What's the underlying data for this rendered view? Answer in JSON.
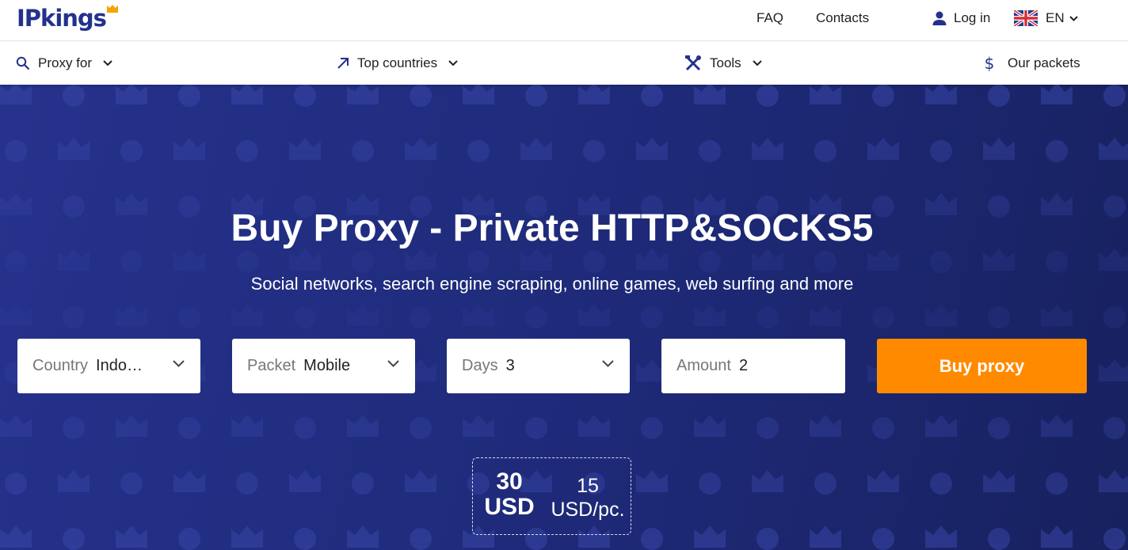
{
  "header": {
    "logo_text": "IPkings",
    "faq": "FAQ",
    "contacts": "Contacts",
    "login": "Log in",
    "language": "EN"
  },
  "nav": {
    "proxy_for": "Proxy for",
    "top_countries": "Top countries",
    "tools": "Tools",
    "our_packets": "Our packets"
  },
  "hero": {
    "title": "Buy Proxy - Private HTTP&SOCKS5",
    "subtitle": "Social networks, search engine scraping, online games, web surfing and more"
  },
  "form": {
    "country_label": "Country",
    "country_value": "Indonesia",
    "packet_label": "Packet",
    "packet_value": "Mobile",
    "days_label": "Days",
    "days_value": "3",
    "amount_label": "Amount",
    "amount_value": "2",
    "buy_button": "Buy proxy"
  },
  "price": {
    "total_amount": "30",
    "total_currency": "USD",
    "per_amount": "15",
    "per_unit": "USD/pc."
  },
  "colors": {
    "brand": "#23318c",
    "accent": "#ff8a00",
    "hero_bg": "#1e2a78"
  },
  "icons": [
    "crown-icon",
    "user-icon",
    "uk-flag-icon",
    "chevron-down-icon",
    "search-icon",
    "arrow-up-right-icon",
    "tools-icon",
    "dollar-icon"
  ]
}
